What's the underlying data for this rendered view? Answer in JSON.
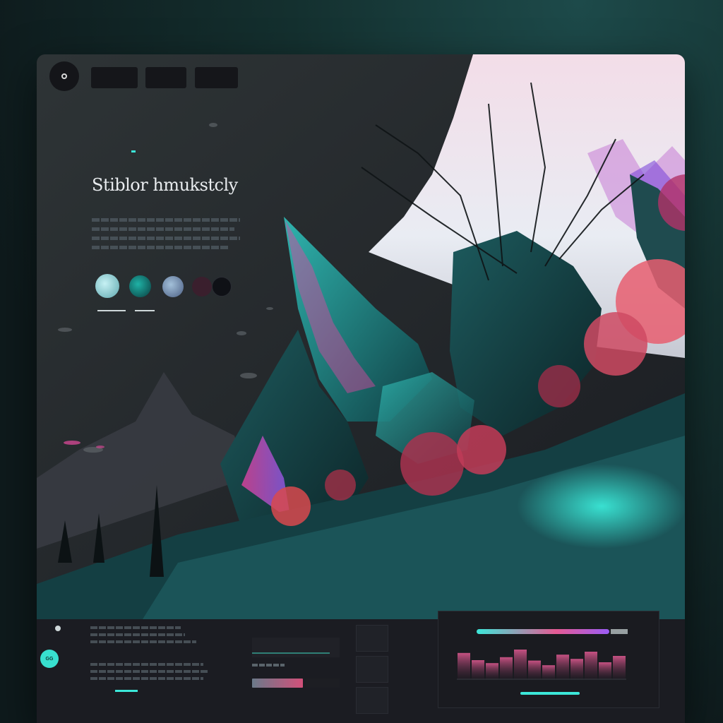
{
  "colors": {
    "accent": "#3ce7d9",
    "pink": "#e55b94",
    "violet": "#9b5cf6",
    "background": "#1b1c22"
  },
  "icons": {
    "logo": "circle-logo-icon",
    "footer_icon": "dot-icon"
  },
  "header": {
    "nav": [
      "",
      "",
      "",
      ""
    ]
  },
  "hero": {
    "title": "Stiblor hmukstcly"
  },
  "footer": {
    "badge": "GG"
  },
  "chart_data": {
    "type": "bar",
    "values": [
      0.62,
      0.45,
      0.38,
      0.52,
      0.7,
      0.44,
      0.33,
      0.58,
      0.48,
      0.65,
      0.4,
      0.55
    ]
  }
}
